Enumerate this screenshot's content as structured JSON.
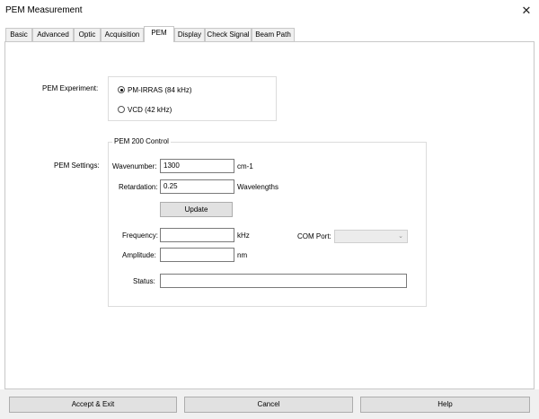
{
  "window": {
    "title": "PEM Measurement",
    "close_glyph": "✕"
  },
  "tabs": [
    {
      "label": "Basic"
    },
    {
      "label": "Advanced"
    },
    {
      "label": "Optic"
    },
    {
      "label": "Acquisition"
    },
    {
      "label": "PEM",
      "active": true
    },
    {
      "label": "Display"
    },
    {
      "label": "Check Signal"
    },
    {
      "label": "Beam Path"
    }
  ],
  "experiment": {
    "label": "PEM Experiment:",
    "options": [
      {
        "label": "PM-IRRAS (84 kHz)",
        "selected": true
      },
      {
        "label": "VCD (42 kHz)",
        "selected": false
      }
    ]
  },
  "control": {
    "group_title": "PEM 200 Control",
    "settings_label": "PEM Settings:",
    "wavenumber": {
      "label": "Wavenumber:",
      "value": "1300",
      "unit": "cm-1"
    },
    "retardation": {
      "label": "Retardation:",
      "value": "0.25",
      "unit": "Wavelengths"
    },
    "update_label": "Update",
    "frequency": {
      "label": "Frequency:",
      "value": "",
      "unit": "kHz"
    },
    "amplitude": {
      "label": "Amplitude:",
      "value": "",
      "unit": "nm"
    },
    "com_port": {
      "label": "COM Port:",
      "value": ""
    },
    "status": {
      "label": "Status:",
      "value": ""
    }
  },
  "footer": {
    "accept_label": "Accept & Exit",
    "cancel_label": "Cancel",
    "help_label": "Help"
  }
}
